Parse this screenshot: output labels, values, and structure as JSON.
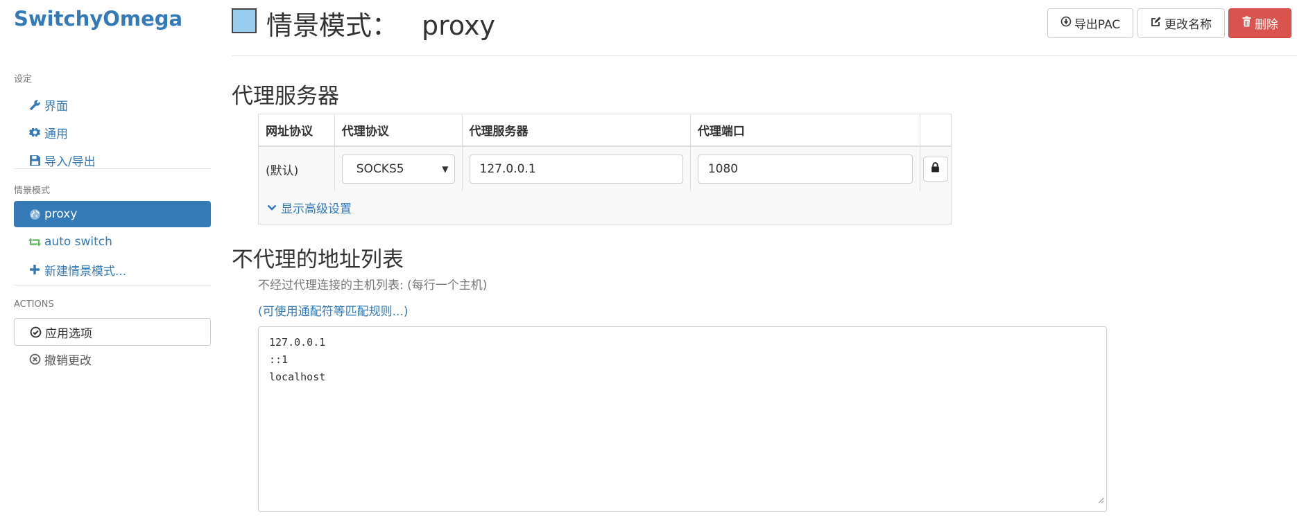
{
  "app": {
    "brand": "SwitchyOmega"
  },
  "sidebar": {
    "settings_header": "设定",
    "settings_items": [
      {
        "label": "界面",
        "icon": "wrench-icon"
      },
      {
        "label": "通用",
        "icon": "gear-icon"
      },
      {
        "label": "导入/导出",
        "icon": "hdd-icon"
      }
    ],
    "profiles_header": "情景模式",
    "profiles": [
      {
        "label": "proxy",
        "icon": "globe-icon",
        "active": true
      },
      {
        "label": "auto switch",
        "icon": "retweet-icon",
        "active": false
      },
      {
        "label": "新建情景模式...",
        "icon": "plus-icon",
        "active": false
      }
    ],
    "actions_header": "ACTIONS",
    "actions": [
      {
        "label": "应用选项",
        "icon": "check-circle-icon"
      },
      {
        "label": "撤销更改",
        "icon": "x-circle-icon"
      }
    ]
  },
  "header": {
    "prefix": "情景模式：",
    "profile_name": "proxy",
    "profile_color": "#99ccee",
    "buttons": {
      "export_pac": "导出PAC",
      "rename": "更改名称",
      "delete": "删除"
    }
  },
  "proxy_section": {
    "title": "代理服务器",
    "columns": [
      "网址协议",
      "代理协议",
      "代理服务器",
      "代理端口"
    ],
    "row": {
      "scheme": "(默认)",
      "protocol": "SOCKS5",
      "server": "127.0.0.1",
      "port": "1080"
    },
    "advanced_link": "显示高级设置"
  },
  "bypass_section": {
    "title": "不代理的地址列表",
    "help": "不经过代理连接的主机列表: (每行一个主机)",
    "wildcard_link": "(可使用通配符等匹配规则...)",
    "entries": [
      "127.0.0.1",
      "::1",
      "localhost"
    ]
  },
  "colors": {
    "primary": "#337ab7",
    "danger": "#d9534f",
    "auto_switch_icon": "#5cb85c"
  }
}
